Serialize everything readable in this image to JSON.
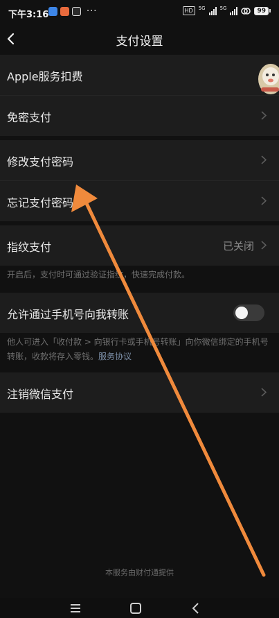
{
  "status_bar": {
    "time": "下午3:16",
    "more": "···",
    "hd_badge": "HD",
    "net1": "5G",
    "net2": "5G",
    "battery": "99"
  },
  "nav": {
    "title": "支付设置"
  },
  "groups": [
    {
      "rows": [
        {
          "label": "Apple服务扣费"
        },
        {
          "label": "免密支付"
        }
      ]
    },
    {
      "rows": [
        {
          "label": "修改支付密码"
        },
        {
          "label": "忘记支付密码"
        }
      ]
    }
  ],
  "fingerprint": {
    "label": "指纹支付",
    "value": "已关闭",
    "hint": "开启后，支付时可通过验证指纹，快速完成付款。"
  },
  "phone_transfer": {
    "label": "允许通过手机号向我转账",
    "enabled": false,
    "hint": "他人可进入「收付款 > 向银行卡或手机号转账」向你微信绑定的手机号转账，收款将存入零钱。",
    "link": "服务协议"
  },
  "close_wechat_pay": {
    "label": "注销微信支付"
  },
  "footer": "本服务由财付通提供",
  "colors": {
    "accent_arrow": "#f08a3c",
    "link": "#7d90a9",
    "background": "#111111",
    "card": "#1d1d1d"
  }
}
